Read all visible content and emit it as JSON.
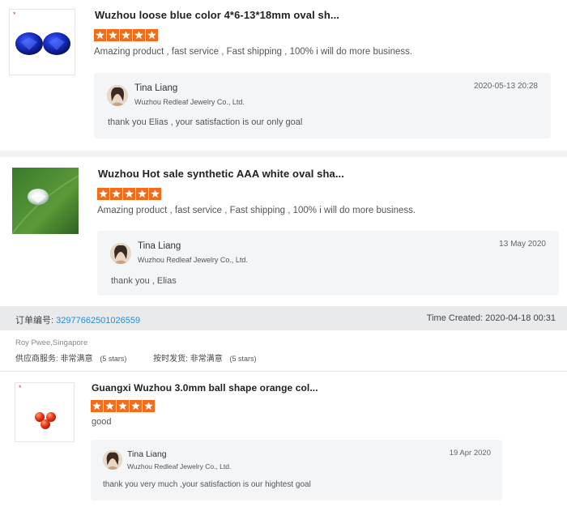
{
  "reviews": [
    {
      "title": "Wuzhou loose blue color 4*6-13*18mm oval sh...",
      "stars": 5,
      "comment": "Amazing product , fast service , Fast shipping , 100% i will do more business.",
      "reply": {
        "name": "Tina Liang",
        "company": "Wuzhou Redleaf Jewelry Co., Ltd.",
        "text": "thank you Elias ,  your satisfaction is our only goal",
        "date": "2020-05-13 20:28"
      },
      "thumb_marker": "*"
    },
    {
      "title": "Wuzhou Hot sale synthetic AAA white oval sha...",
      "stars": 5,
      "comment": "Amazing product , fast service , Fast shipping , 100% i will do more business.",
      "reply": {
        "name": "Tina Liang",
        "company": "Wuzhou Redleaf Jewelry Co., Ltd.",
        "text": "thank you , Elias",
        "date": "13 May 2020"
      }
    },
    {
      "title": "Guangxi Wuzhou 3.0mm ball shape orange col...",
      "stars": 5,
      "comment": "good",
      "reply": {
        "name": "Tina Liang",
        "company": "Wuzhou Redleaf Jewelry Co., Ltd.",
        "text": "thank you very much ,your satisfaction is our hightest goal",
        "date": "19 Apr 2020"
      },
      "thumb_marker": "*"
    }
  ],
  "order": {
    "label": "订单编号:",
    "number": "32977662501026559",
    "time_created": "Time Created: 2020-04-18 00:31",
    "buyer": "Roy Pwee,Singapore",
    "supplier_service_label": "供应商服务: 非常满意",
    "supplier_service_stars": "(5 stars)",
    "on_time_label": "按时发货: 非常满意",
    "on_time_stars": "(5 stars)"
  },
  "colors": {
    "star": "#f26c1c",
    "link": "#2a8bd6",
    "reply_bg": "#f4f5f7"
  },
  "icons": {
    "star": "star-icon",
    "avatar": "avatar"
  }
}
